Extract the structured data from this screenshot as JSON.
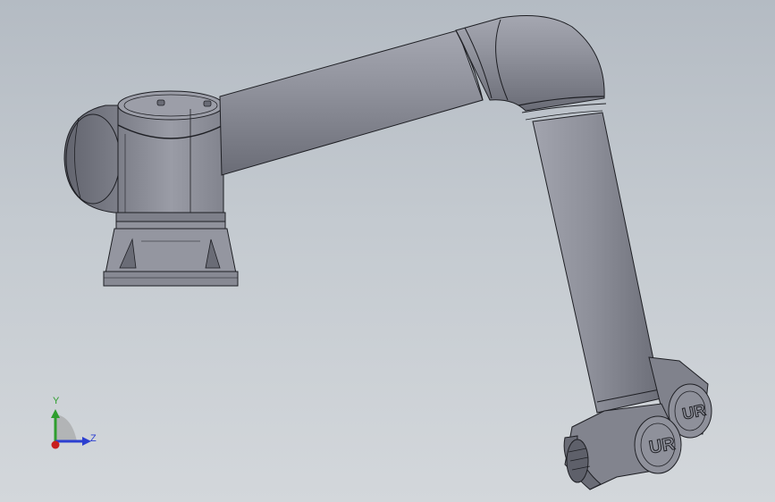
{
  "viewport": {
    "background_top": "#b4bbc3",
    "background_bottom": "#d3d7db"
  },
  "model": {
    "kind": "robot-arm",
    "body_color": "#8c8e99",
    "edge_color": "#1e1f24",
    "logo_text": "UR"
  },
  "triad": {
    "y_label": "Y",
    "z_label": "Z",
    "y_color": "#2e9e2e",
    "z_color": "#2c3fd0",
    "x_color": "#c81e1e"
  }
}
